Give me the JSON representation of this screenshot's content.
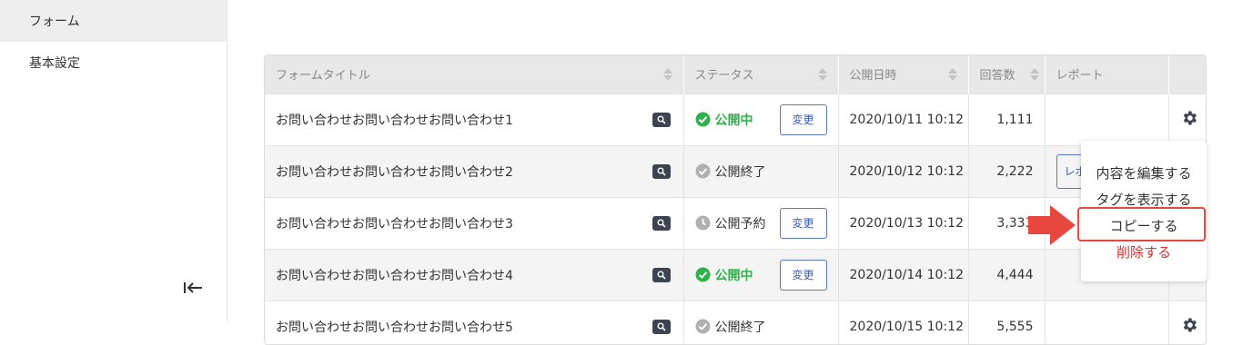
{
  "sidebar": {
    "items": [
      {
        "label": "フォーム",
        "active": true
      },
      {
        "label": "基本設定",
        "active": false
      }
    ],
    "collapse_icon": "collapse-left-icon"
  },
  "table": {
    "headers": {
      "title": "フォームタイトル",
      "status": "ステータス",
      "published_at": "公開日時",
      "responses": "回答数",
      "report": "レポート"
    },
    "change_label": "変更",
    "report_label": "レポ",
    "rows": [
      {
        "title": "お問い合わせお問い合わせお問い合わせ1",
        "status": "公開中",
        "date": "2020/10/11 10:12",
        "count": "1,111"
      },
      {
        "title": "お問い合わせお問い合わせお問い合わせ2",
        "status": "公開終了",
        "date": "2020/10/12 10:12",
        "count": "2,222"
      },
      {
        "title": "お問い合わせお問い合わせお問い合わせ3",
        "status": "公開予約",
        "date": "2020/10/13 10:12",
        "count": "3,333"
      },
      {
        "title": "お問い合わせお問い合わせお問い合わせ4",
        "status": "公開中",
        "date": "2020/10/14 10:12",
        "count": "4,444"
      },
      {
        "title": "お問い合わせお問い合わせお問い合わせ5",
        "status": "公開終了",
        "date": "2020/10/15 10:12",
        "count": "5,555"
      }
    ]
  },
  "menu": {
    "edit": "内容を編集する",
    "show_tags": "タグを表示する",
    "copy": "コピーする",
    "delete": "削除する"
  },
  "colors": {
    "published": "#2db34a",
    "muted_icon": "#b0b0b0",
    "accent": "#3c5bb8",
    "danger": "#e0322d",
    "highlight": "#e8473f"
  }
}
